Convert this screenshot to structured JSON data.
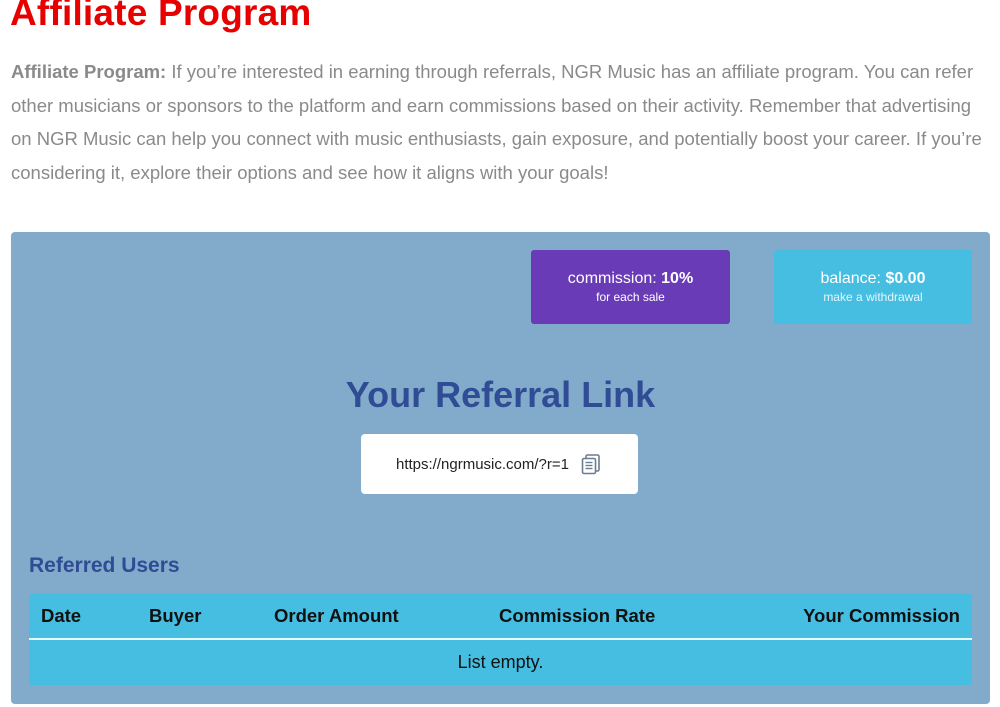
{
  "page": {
    "title": "Affiliate Program",
    "intro_lead": "Affiliate Program:",
    "intro_text": " If you’re interested in earning through referrals, NGR Music has an affiliate program. You can refer other musicians or sponsors to the platform and earn commissions based on their activity. Remember that advertising on NGR Music can help you connect with music enthusiasts, gain exposure, and potentially boost your career. If you’re considering it, explore their options and see how it aligns with your goals!"
  },
  "stats": {
    "commission_label": "commission: ",
    "commission_value": "10%",
    "commission_sub": "for each sale",
    "balance_label": "balance: ",
    "balance_value": "$0.00",
    "balance_sub": "make a withdrawal"
  },
  "referral": {
    "title": "Your Referral Link",
    "link": "https://ngrmusic.com/?r=1",
    "copy_icon": "copy-icon"
  },
  "users": {
    "title": "Referred Users",
    "columns": [
      "Date",
      "Buyer",
      "Order Amount",
      "Commission Rate",
      "Your Commission"
    ],
    "empty_text": "List empty."
  },
  "colors": {
    "title_red": "#e60000",
    "panel_blue": "#82abcb",
    "commission_purple": "#6a3bb7",
    "balance_cyan": "#45bee1",
    "heading_navy": "#2f4c94"
  }
}
